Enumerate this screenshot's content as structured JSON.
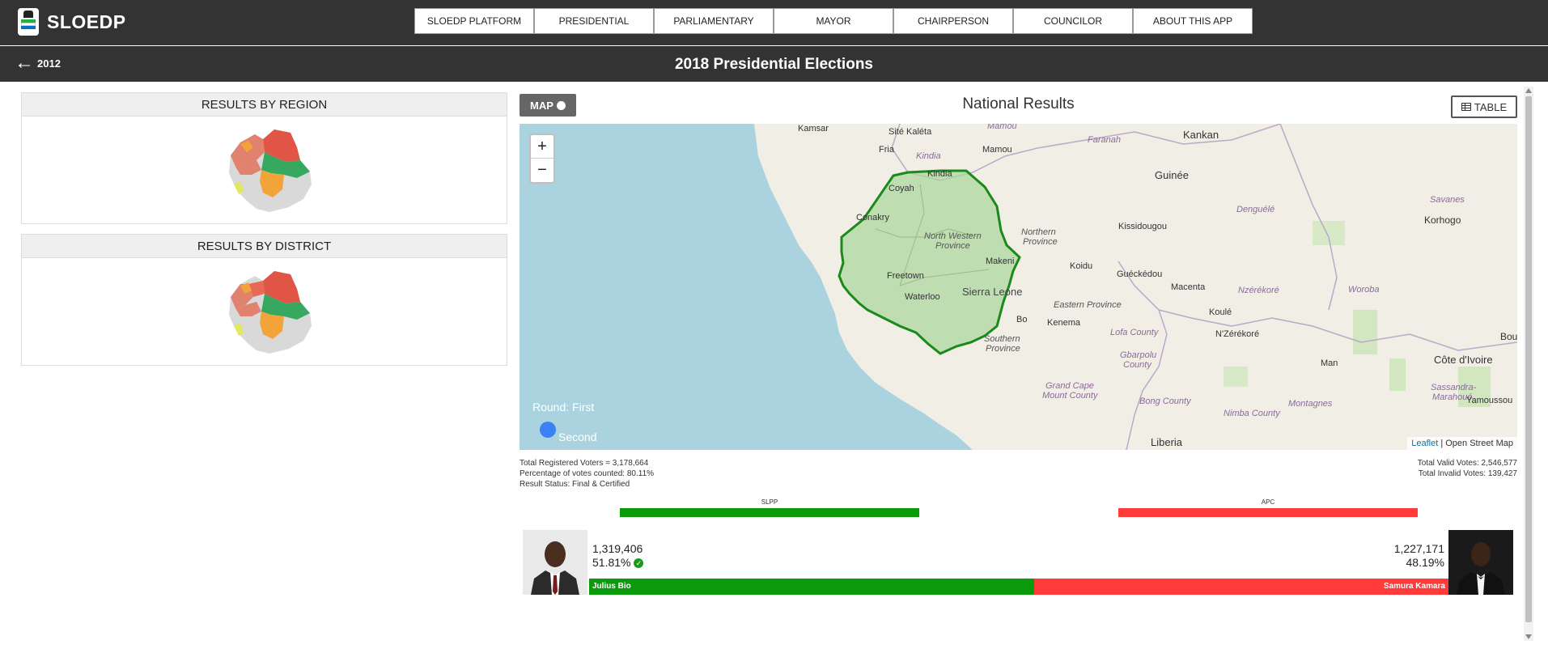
{
  "app": {
    "name": "SLOEDP"
  },
  "nav": [
    "SLOEDP PLATFORM",
    "PRESIDENTIAL",
    "PARLIAMENTARY",
    "MAYOR",
    "CHAIRPERSON",
    "COUNCILOR",
    "ABOUT THIS APP"
  ],
  "subheader": {
    "back_label": "2012",
    "title": "2018 Presidential Elections"
  },
  "left": {
    "region_title": "RESULTS BY REGION",
    "district_title": "RESULTS BY DISTRICT"
  },
  "panel": {
    "map_label": "MAP",
    "title": "National Results",
    "table_label": "TABLE"
  },
  "map": {
    "labels": {
      "kamsar": "Kamsar",
      "site_kaleta": "Sité Kaléta",
      "mamou_region": "Mamou",
      "faranah": "Faranah",
      "kankan": "Kankan",
      "fria": "Fria",
      "kindia_region": "Kindia",
      "mamou": "Mamou",
      "kindia": "Kindia",
      "guinee": "Guinée",
      "coyah": "Coyah",
      "conakry": "Conakry",
      "kissidougou": "Kissidougou",
      "denguele": "Denguélé",
      "savanes": "Savanes",
      "korhogo": "Korhogo",
      "north_western": "North Western",
      "province1": "Province",
      "northern": "Northern",
      "province2": "Province",
      "makeni": "Makeni",
      "koidu": "Koidu",
      "guekedou": "Guéckédou",
      "macenta": "Macenta",
      "nzerekore_region": "Nzérékoré",
      "woroba": "Woroba",
      "freetown": "Freetown",
      "sierra_leone": "Sierra Leone",
      "waterloo": "Waterloo",
      "eastern": "Eastern Province",
      "koule": "Koulé",
      "bo": "Bo",
      "kenema": "Kenema",
      "lofa": "Lofa County",
      "nzerekore": "N'Zérékoré",
      "bou": "Bou",
      "southern": "Southern",
      "province3": "Province",
      "gbarpolu": "Gbarpolu",
      "county1": "County",
      "man": "Man",
      "cote_divoire": "Côte d'Ivoire",
      "sassandra": "Sassandra-",
      "marahoue": "Marahoué",
      "yamoussoukro": "Yamoussou",
      "grand_cape": "Grand Cape",
      "mount_county": "Mount County",
      "bong": "Bong County",
      "montagnes": "Montagnes",
      "nimba": "Nimba County",
      "liberia": "Liberia"
    },
    "round_label": "Round: First",
    "round_second": "Second",
    "attrib_leaflet": "Leaflet",
    "attrib_osm": "| Open Street Map",
    "zoom_in": "+",
    "zoom_out": "−"
  },
  "stats": {
    "registered": "Total Registered Voters = 3,178,664",
    "percent_counted": "Percentage of votes counted: 80.11%",
    "status": "Result Status: Final & Certified",
    "valid": "Total Valid Votes: 2,546,577",
    "invalid": "Total Invalid Votes: 139,427"
  },
  "parties": [
    {
      "name": "SLPP",
      "color": "#0a9a0a"
    },
    {
      "name": "APC",
      "color": "#ff3b3b"
    }
  ],
  "candidates": [
    {
      "name": "Julius Bio",
      "votes": "1,319,406",
      "percent": "51.81%",
      "share": 0.5181,
      "winner": true
    },
    {
      "name": "Samura Kamara",
      "votes": "1,227,171",
      "percent": "48.19%",
      "share": 0.4819,
      "winner": false
    }
  ]
}
